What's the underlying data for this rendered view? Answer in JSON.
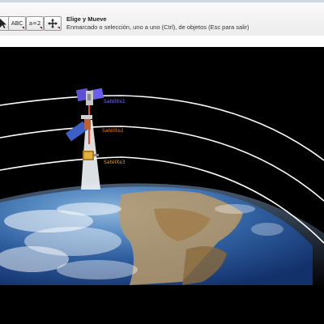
{
  "toolbar": {
    "tool_title": "Elige y Mueve",
    "tool_description": "Enmarcado o selección, uno a uno (Ctrl), de objetos (Esc para salir)",
    "tools": [
      {
        "name": "move-tool-button",
        "label": "",
        "icon": "arrow-icon"
      },
      {
        "name": "text-tool-button",
        "label": "ABC",
        "icon": "text-icon"
      },
      {
        "name": "slider-tool-button",
        "label": "a=2",
        "icon": "slider-icon"
      },
      {
        "name": "move-view-tool-button",
        "label": "",
        "icon": "move-view-icon"
      }
    ]
  },
  "graphics": {
    "satellites": [
      {
        "label": "Satélite1",
        "color": "#7a6cf0"
      },
      {
        "label": "Satélite2",
        "color": "#e07a2a"
      },
      {
        "label": "Satélite3",
        "color": "#d8a030"
      }
    ],
    "orbit_color": "#ffffff",
    "background_color": "#000000"
  }
}
